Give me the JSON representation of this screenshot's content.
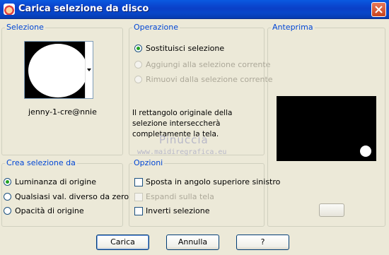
{
  "window": {
    "title": "Carica selezione da disco"
  },
  "selezione": {
    "legend": "Selezione",
    "file_name": "jenny-1-cre@nnie"
  },
  "operazione": {
    "legend": "Operazione",
    "options": [
      {
        "label": "Sostituisci selezione",
        "selected": true,
        "enabled": true
      },
      {
        "label": "Aggiungi alla selezione corrente",
        "selected": false,
        "enabled": false
      },
      {
        "label": "Rimuovi dalla selezione corrente",
        "selected": false,
        "enabled": false
      }
    ],
    "info": "Il rettangolo originale della selezione interseccherà completamente la tela."
  },
  "anteprima": {
    "legend": "Anteprima"
  },
  "crea_da": {
    "legend": "Crea selezione da",
    "options": [
      {
        "label": "Luminanza di origine",
        "selected": true
      },
      {
        "label": "Qualsiasi val. diverso da zero",
        "selected": false
      },
      {
        "label": "Opacità di origine",
        "selected": false
      }
    ]
  },
  "opzioni": {
    "legend": "Opzioni",
    "checks": [
      {
        "label": "Sposta in angolo superiore sinistro",
        "checked": false,
        "enabled": true
      },
      {
        "label": "Espandi sulla tela",
        "checked": false,
        "enabled": false
      },
      {
        "label": "Inverti selezione",
        "checked": false,
        "enabled": true
      }
    ]
  },
  "watermark": {
    "name": "Pinuccia",
    "url": "www.maidiregrafica.eu"
  },
  "buttons": {
    "load": "Carica",
    "cancel": "Annulla",
    "help": "?"
  },
  "colors": {
    "titlebar": "#0a4fd6",
    "legend": "#0046d5",
    "radio_selected": "#21a121"
  }
}
